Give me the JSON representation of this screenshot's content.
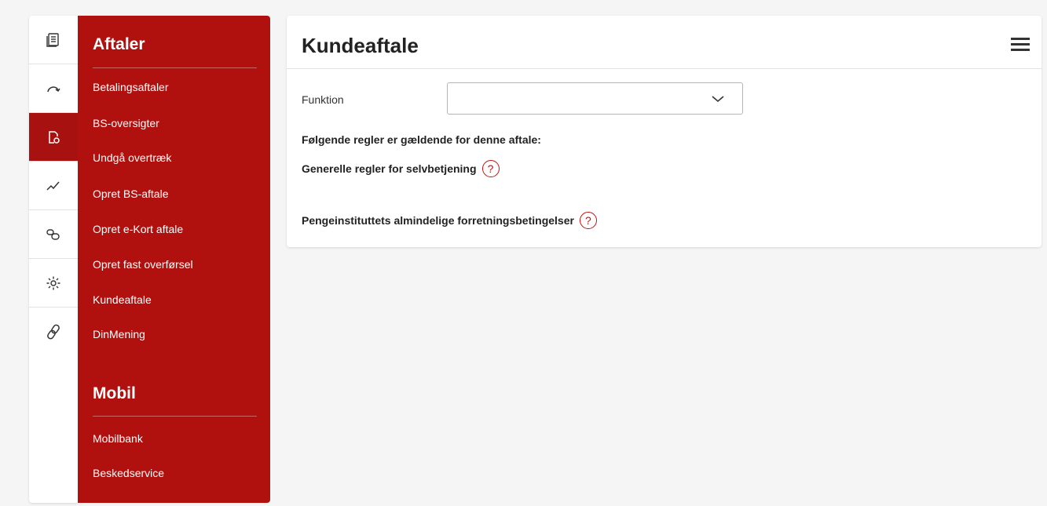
{
  "colors": {
    "brand_red": "#b0110e",
    "active_rail": "#a71210",
    "help_icon": "#c0110e"
  },
  "rail": {
    "items": [
      {
        "icon": "document-list-icon",
        "active": false
      },
      {
        "icon": "transfer-arrow-icon",
        "active": false
      },
      {
        "icon": "document-agreement-icon",
        "active": true
      },
      {
        "icon": "chart-line-icon",
        "active": false
      },
      {
        "icon": "chat-bubbles-icon",
        "active": false
      },
      {
        "icon": "gear-icon",
        "active": false
      },
      {
        "icon": "link-icon",
        "active": false
      }
    ]
  },
  "menu": {
    "section1": {
      "heading": "Aftaler",
      "links": [
        "Betalingsaftaler",
        "BS-oversigter",
        "Undgå overtræk",
        "Opret BS-aftale",
        "Opret e-Kort aftale",
        "Opret fast overførsel",
        "Kundeaftale",
        "DinMening"
      ]
    },
    "section2": {
      "heading": "Mobil",
      "links": [
        "Mobilbank",
        "Beskedservice"
      ]
    }
  },
  "main": {
    "title": "Kundeaftale",
    "function_label": "Funktion",
    "function_value": "",
    "rules_title": "Følgende regler er gældende for denne aftale:",
    "rule1": "Generelle regler for selvbetjening",
    "rule2": "Pengeinstituttets almindelige forretningsbetingelser",
    "help_symbol": "?"
  }
}
